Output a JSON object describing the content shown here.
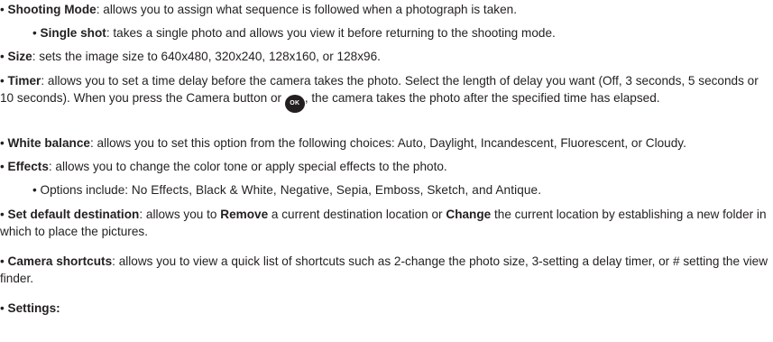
{
  "bullet": "•",
  "shooting_mode": {
    "term": "Shooting Mode",
    "desc": ": allows you to assign what sequence is followed when a photograph is taken."
  },
  "single_shot": {
    "term": "Single shot",
    "desc": ": takes a single photo and allows you view it before returning to the shooting mode."
  },
  "size": {
    "term": "Size",
    "desc": ": sets the image size to 640x480, 320x240, 128x160, or 128x96."
  },
  "timer": {
    "term": "Timer",
    "desc_before": ": allows you to set a time delay before the camera takes the photo. Select the length of delay you want (Off, 3 seconds, 5 seconds or 10 seconds). When you press the Camera button or ",
    "icon_label": "OK",
    "desc_after": ", the camera takes the photo after the specified time has elapsed."
  },
  "white_balance": {
    "term": "White balance",
    "desc": ": allows you to set this option from the following choices: Auto, Daylight, Incandescent, Fluorescent, or Cloudy."
  },
  "effects": {
    "term": "Effects",
    "desc": ": allows you to change the color tone or apply special effects to the photo."
  },
  "effects_options": {
    "lead": "Options include: ",
    "list": "No Effects, Black & White, Negative, Sepia, Emboss, Sketch, and Antique."
  },
  "default_destination": {
    "term": "Set default destination",
    "desc1": ": allows you to ",
    "remove": "Remove",
    "desc2": " a current destination location or ",
    "change": "Change",
    "desc3": " the current location by establishing a new folder in which to place the pictures."
  },
  "camera_shortcuts": {
    "term": "Camera shortcuts",
    "desc": ": allows you to view a quick list of shortcuts such as 2-change the photo size, 3-setting a delay timer, or # setting the view finder."
  },
  "settings": {
    "term": "Settings:"
  }
}
